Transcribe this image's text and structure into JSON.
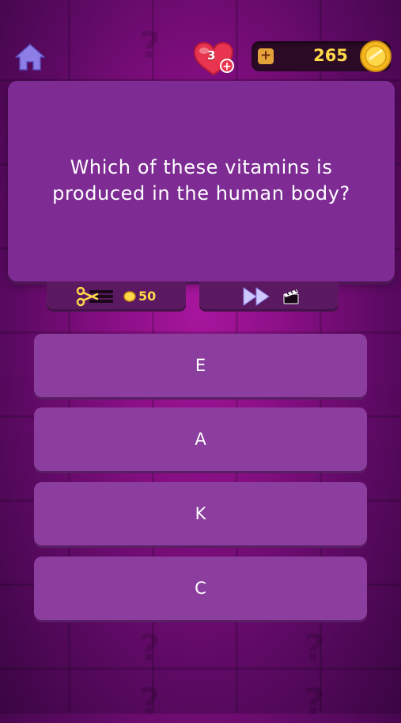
{
  "header": {
    "home_icon": "home-icon",
    "lives": {
      "count": "3",
      "icon": "heart-icon",
      "plus_label": "+"
    },
    "coins": {
      "add_label": "+",
      "amount": "265",
      "icon": "coin-icon"
    }
  },
  "question": {
    "text": "Which of these vitamins is produced in the human body?"
  },
  "lifelines": {
    "fifty_fifty": {
      "icon": "scissors-icon",
      "cost": "50"
    },
    "skip": {
      "icon": "fast-forward-icon",
      "video_icon": "clapperboard-icon"
    }
  },
  "answers": [
    {
      "label": "E"
    },
    {
      "label": "A"
    },
    {
      "label": "K"
    },
    {
      "label": "C"
    }
  ],
  "colors": {
    "background": "#8a0f86",
    "card": "#7e2c94",
    "answer": "#8c3e9e",
    "gold": "#ffd84a",
    "heart": "#e8344e"
  }
}
